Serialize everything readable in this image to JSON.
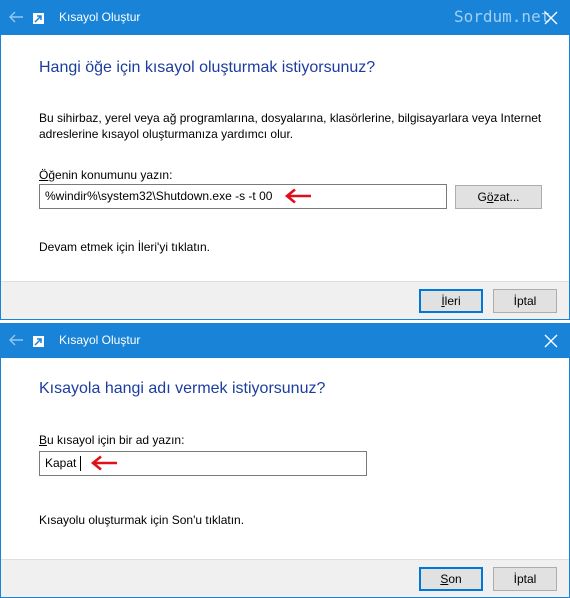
{
  "watermark": "Sordum.net",
  "dialog1": {
    "title": "Kısayol Oluştur",
    "heading": "Hangi öğe için kısayol oluşturmak istiyorsunuz?",
    "description_line1": "Bu sihirbaz, yerel veya ağ programlarına, dosyalarına, klasörlerine, bilgisayarlara veya Internet",
    "description_line2": "adreslerine kısayol oluşturmanıza yardımcı olur.",
    "location_label": {
      "accel": "Ö",
      "rest": "ğenin konumunu yazın:"
    },
    "location_value": "%windir%\\system32\\Shutdown.exe -s -t 00",
    "browse_button": {
      "pre": "G",
      "accel": "ö",
      "post": "zat..."
    },
    "instruction": "Devam etmek için İleri'yi tıklatın.",
    "next_button": {
      "accel": "İ",
      "rest": "leri"
    },
    "cancel_button": "İptal"
  },
  "dialog2": {
    "title": "Kısayol Oluştur",
    "heading": "Kısayola hangi adı vermek istiyorsunuz?",
    "name_label": {
      "accel": "B",
      "rest": "u kısayol için bir ad yazın:"
    },
    "name_value": "Kapat",
    "instruction": "Kısayolu oluşturmak için Son'u tıklatın.",
    "finish_button": {
      "accel": "S",
      "rest": "on"
    },
    "cancel_button": "İptal"
  },
  "icons": [
    "back-arrow-icon",
    "shortcut-icon",
    "close-icon",
    "red-arrow-icon"
  ],
  "colors": {
    "titlebar": "#1883d7",
    "heading": "#1d3d9e",
    "annotation_arrow": "#e0101a",
    "default_button_border": "#0078d7"
  }
}
